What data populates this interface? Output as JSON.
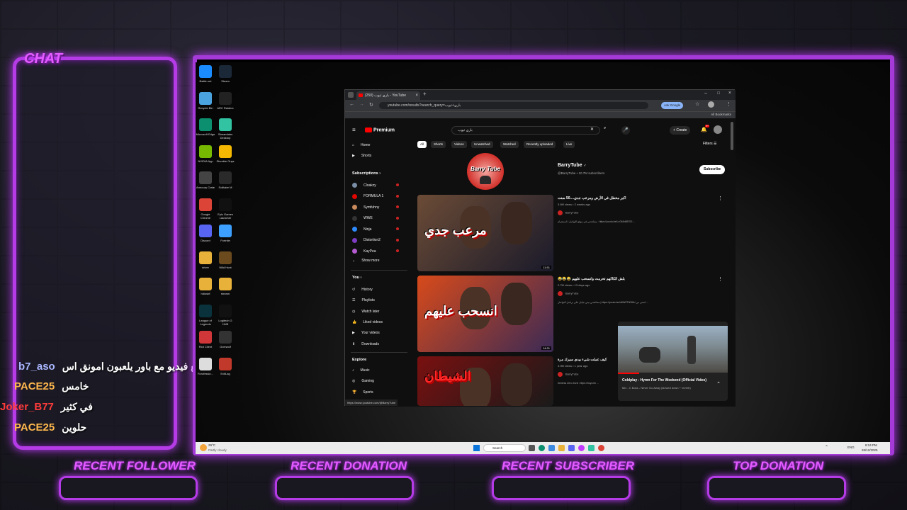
{
  "overlay": {
    "chat_title": "CHAT",
    "chat_messages": [
      {
        "user": "b7_aso",
        "message": "حتى قد طلع فيديو مع باور يلعبون امونق اس",
        "color": "#a9b7ff"
      },
      {
        "user": "PACE25",
        "message": "خامس",
        "color": "#ffb84d"
      },
      {
        "user": "Joker_B77",
        "message": "في كثير",
        "color": "#ff3b3b"
      },
      {
        "user": "PACE25",
        "message": "حلوين",
        "color": "#ffb84d"
      }
    ],
    "panels": [
      "RECENT FOLLOWER",
      "RECENT DONATION",
      "RECENT SUBSCRIBER",
      "TOP DONATION"
    ],
    "accent": "#b43be6"
  },
  "desktop_icons": [
    {
      "label": "Battle.net",
      "icon": "battlenet-icon",
      "color": "#1a8cff"
    },
    {
      "label": "Steam",
      "icon": "steam-icon",
      "color": "#1b2838"
    },
    {
      "label": "Recycle Bin",
      "icon": "recycle-bin-icon",
      "color": "#4aa3df"
    },
    {
      "label": "ARC Raiders",
      "icon": "arc-raiders-icon",
      "color": "#222"
    },
    {
      "label": "Microsoft Edge",
      "icon": "edge-icon",
      "color": "#0c8f6e"
    },
    {
      "label": "Streamlabs Desktop",
      "icon": "streamlabs-icon",
      "color": "#31c3a2"
    },
    {
      "label": "NVIDIA App",
      "icon": "nvidia-icon",
      "color": "#76b900"
    },
    {
      "label": "Stumble Guys",
      "icon": "stumble-guys-icon",
      "color": "#f5b800"
    },
    {
      "label": "Armoury Crate",
      "icon": "armoury-crate-icon",
      "color": "#444"
    },
    {
      "label": "Solitaire M",
      "icon": "solitaire-icon",
      "color": "#2a2a2a"
    },
    {
      "label": "Google Chrome",
      "icon": "chrome-icon",
      "color": "#db4437"
    },
    {
      "label": "Epic Games Launcher",
      "icon": "epic-games-icon",
      "color": "#111"
    },
    {
      "label": "Discord",
      "icon": "discord-icon",
      "color": "#5865f2"
    },
    {
      "label": "Fortnite",
      "icon": "fortnite-icon",
      "color": "#3da0ff"
    },
    {
      "label": "driver",
      "icon": "folder-icon",
      "color": "#e8b13a"
    },
    {
      "label": "Wild Hunt",
      "icon": "wild-hunt-icon",
      "color": "#6b4a1e"
    },
    {
      "label": "hdiusbf",
      "icon": "folder-icon",
      "color": "#e8b13a"
    },
    {
      "label": "stream",
      "icon": "folder-icon",
      "color": "#e8b13a"
    },
    {
      "label": "League of Legends",
      "icon": "league-icon",
      "color": "#0a323c"
    },
    {
      "label": "Logitech G HUB",
      "icon": "logitech-icon",
      "color": "#111"
    },
    {
      "label": "Riot Client",
      "icon": "riot-icon",
      "color": "#d13639"
    },
    {
      "label": "Overwolf",
      "icon": "overwolf-icon",
      "color": "#333"
    },
    {
      "label": "Forofessio...",
      "icon": "app-icon",
      "color": "#ddd"
    },
    {
      "label": "ExitLag",
      "icon": "exitlag-icon",
      "color": "#c0392b"
    }
  ],
  "browser": {
    "tab_title": "باري تيوب (250) - YouTube",
    "url": "youtube.com/results?search_query=باري+تيوب",
    "ask_google": "Ask Google",
    "all_bookmarks": "All Bookmarks",
    "status_url": "https://www.youtube.com/@BarryTube"
  },
  "youtube": {
    "logo": "Premium",
    "search_query": "باري تيوب",
    "create": "Create",
    "notif_count": "9+",
    "chips": [
      "All",
      "Shorts",
      "Videos",
      "Unwatched",
      "Watched",
      "Recently uploaded",
      "Live"
    ],
    "filters": "Filters",
    "nav": {
      "home": "Home",
      "shorts": "Shorts",
      "subscriptions_header": "Subscriptions",
      "subscriptions": [
        {
          "name": "Cloakzy",
          "color": "#7a8fa6"
        },
        {
          "name": "FORMULA 1",
          "color": "#e10600"
        },
        {
          "name": "Symfuhny",
          "color": "#c98a5e"
        },
        {
          "name": "WWE",
          "color": "#333"
        },
        {
          "name": "Ninja",
          "color": "#2e8bff"
        },
        {
          "name": "Distortion2",
          "color": "#7d3cc2"
        },
        {
          "name": "KayPea",
          "color": "#b45bd1"
        }
      ],
      "show_more": "Show more",
      "you_header": "You",
      "you_items": [
        "History",
        "Playlists",
        "Watch later",
        "Liked videos",
        "Your videos",
        "Downloads"
      ],
      "explore_header": "Explore",
      "explore_items": [
        "Music",
        "Gaming",
        "Sports"
      ]
    },
    "channel": {
      "name": "BarryTube",
      "meta": "@BarryTube • 10.7M subscribers",
      "subscribe": "Subscribe",
      "avatar_text": "Barry Tube"
    },
    "videos": [
      {
        "title": "اكبر مخطل في الأرض ومرعب جدي....50 سنت",
        "meta": "3.6M views • 2 weeks ago",
        "channel": "BarryTube",
        "desc": "مشاهدتي في موقع التواصل | انستقرام : https://youtu.be/LcGk5d65700 ...",
        "duration": "11:51",
        "thumb_text": "مرعب جدي",
        "thumb_colors": [
          "#6b4b36",
          "#1a1a2a"
        ]
      },
      {
        "title": "بلش الكاكهم تحرمت وانسحب عليهم 😂😂😂",
        "meta": "2.7M views • 13 days ago",
        "channel": "BarryTube",
        "desc": "مشاهدتي بيتي جيابل على برنامل التواصل | https://youtu.be/o5lWZTN39tU اتمنى من ...",
        "duration": "14:21",
        "thumb_text": "انسحب عليهم",
        "thumb_colors": [
          "#d84a1a",
          "#3b2a55"
        ]
      },
      {
        "title": "كيف عملت شيء بيدي سيرك مرة",
        "meta": "3.9M views • 1 year ago",
        "channel": "BarryTube",
        "desc": "Zenless Zero Zone :https://hoyo.lin ...",
        "duration": "",
        "thumb_text": "الشيطان",
        "thumb_colors": [
          "#7a1010",
          "#1a1a1a"
        ]
      }
    ],
    "miniplayer": {
      "title": "Coldplay - Hymn For The Weekend (Official Video)",
      "subtitle": "Mix - C Boss - Never Go Away (slowed down + reverb)"
    }
  },
  "taskbar": {
    "weather_temp": "29°C",
    "weather_desc": "Partly cloudy",
    "search": "Search",
    "time": "8:24 PM",
    "date": "26/12/2025",
    "lang": "ENG"
  }
}
